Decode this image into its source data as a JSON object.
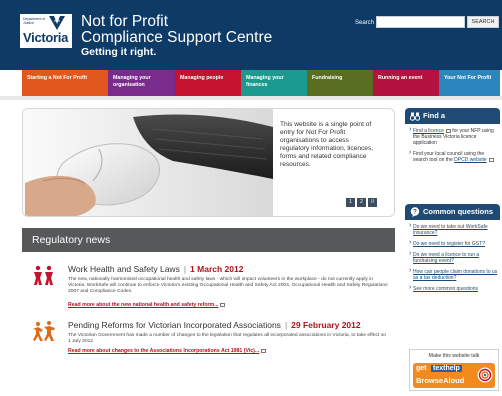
{
  "header": {
    "logo_gov_line1": "Department of",
    "logo_gov_line2": "Justice",
    "logo_state": "Victoria",
    "title_line1": "Not for Profit",
    "title_line2": "Compliance Support Centre",
    "tagline": "Getting it right.",
    "search_label": "Search",
    "search_value": "",
    "search_button": "SEARCH"
  },
  "nav": {
    "items": [
      {
        "label": "Starting a Not For Profit",
        "color": "#e2571e",
        "width": 86
      },
      {
        "label": "Managing your organisation",
        "color": "#7a2c8c",
        "width": 67
      },
      {
        "label": "Managing people",
        "color": "#c4122f",
        "width": 66
      },
      {
        "label": "Managing your finances",
        "color": "#1b9b8f",
        "width": 66
      },
      {
        "label": "Fundraising",
        "color": "#5a6e22",
        "width": 66
      },
      {
        "label": "Running an event",
        "color": "#b3123e",
        "width": 66
      },
      {
        "label": "Your Not For Profit",
        "color": "#2a86bd",
        "width": 61
      }
    ]
  },
  "hero": {
    "text": "This website is a single point of entry for Not For Profit organisations to access regulatory information, licences, forms and related compliance resources.",
    "pager": [
      "1",
      "2",
      "II"
    ]
  },
  "news": {
    "heading": "Regulatory news",
    "items": [
      {
        "title": "Work Health and Safety Laws",
        "date": "1 March 2012",
        "desc": "The new, nationally harmonised occupational health and safety laws - which will impact volunteers in the workplace - do not currently apply in Victoria. WorkSafe will continue to enforce Victoria's existing Occupational Health and Safety Act 2004, Occupational Health and Safety Regulations 2007 and Compliance Codes.",
        "link": "Read more about the new national health and safety reform..."
      },
      {
        "title": "Pending Reforms for Victorian Incorporated Associations",
        "date": "29 February 2012",
        "desc": "The Victorian Government has made a number of changes to the legislation that regulates all incorporated associations in Victoria, to take effect on 1 July 2012.",
        "link": "Read more about changes to the Associations Incorporations Act 1981 (Vic)..."
      }
    ]
  },
  "sidebar": {
    "find": {
      "heading": "Find a",
      "items": [
        {
          "link": "Find a licence",
          "rest": " for your NFP using the Business Victoria licence application"
        },
        {
          "pre": "Find your local council using the search tool on the ",
          "link": "DPCD website"
        }
      ]
    },
    "questions": {
      "heading": "Common questions",
      "items": [
        "Do we need to take out WorkSafe insurance?",
        "Do we need to register for GST?",
        "Do we need a licence to run a fundraising event?",
        "How can people claim donations to us as a tax deduction?"
      ],
      "more": "See more common questions"
    },
    "talk": {
      "label": "Make this website talk",
      "get": "get",
      "brand": "texthelp",
      "product": "BrowseAloud"
    }
  },
  "colors": {
    "header_bg": "#0e3a66",
    "accent_red": "#b3121d",
    "sidebar_head": "#1f4a73"
  }
}
